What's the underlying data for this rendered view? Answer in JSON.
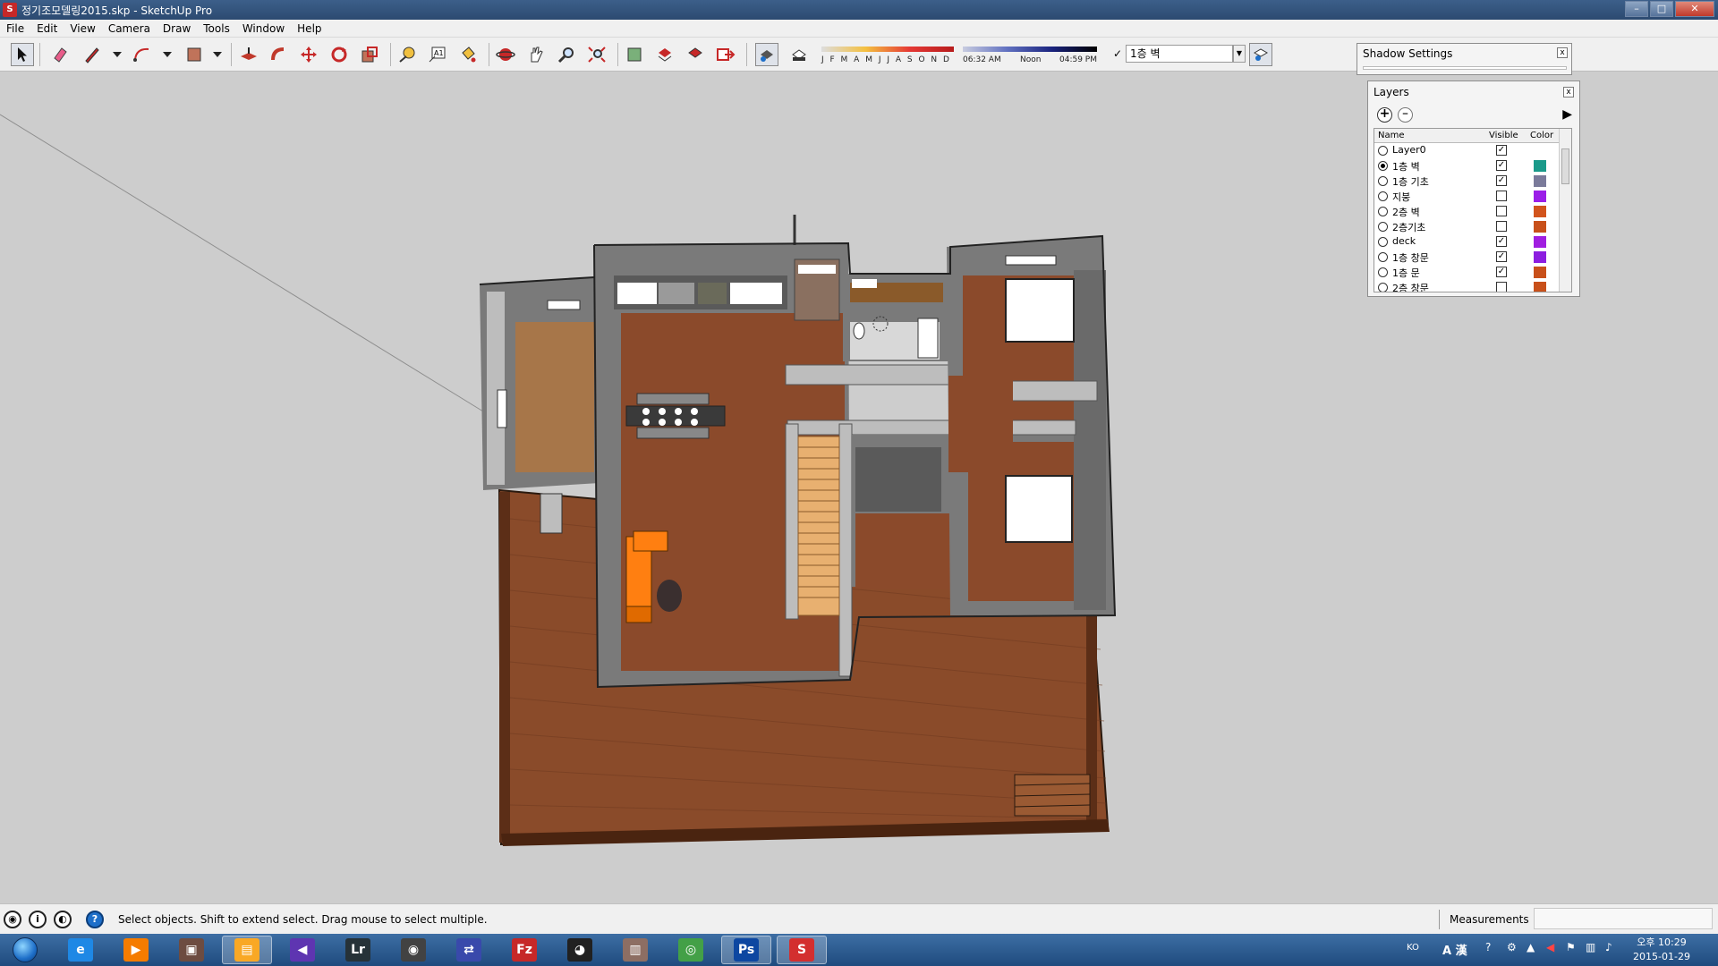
{
  "window": {
    "title": "정기조모델링2015.skp - SketchUp Pro",
    "min_label": "–",
    "max_label": "□",
    "close_label": "✕"
  },
  "menu": [
    "File",
    "Edit",
    "View",
    "Camera",
    "Draw",
    "Tools",
    "Window",
    "Help"
  ],
  "shadow_controls": {
    "months": "J F M A M J J A S O N D",
    "time_start": "06:32 AM",
    "time_mid": "Noon",
    "time_end": "04:59 PM"
  },
  "layer_dropdown": {
    "check": "✓",
    "current": "1층 벽"
  },
  "shadow_panel": {
    "title": "Shadow Settings",
    "close": "x"
  },
  "layers_panel": {
    "title": "Layers",
    "close": "x",
    "headers": {
      "name": "Name",
      "visible": "Visible",
      "color": "Color"
    },
    "layers": [
      {
        "name": "Layer0",
        "active": false,
        "visible": true,
        "color": "#ffffff"
      },
      {
        "name": "1층 벽",
        "active": true,
        "visible": true,
        "color": "#1a9a8a"
      },
      {
        "name": "1층 기초",
        "active": false,
        "visible": true,
        "color": "#7a7a9a"
      },
      {
        "name": "지붕",
        "active": false,
        "visible": false,
        "color": "#9b1ee8"
      },
      {
        "name": "2층 벽",
        "active": false,
        "visible": false,
        "color": "#d2541c"
      },
      {
        "name": "2층기초",
        "active": false,
        "visible": false,
        "color": "#c8501a"
      },
      {
        "name": "deck",
        "active": false,
        "visible": true,
        "color": "#a01ee0"
      },
      {
        "name": "1층 창문",
        "active": false,
        "visible": true,
        "color": "#8c1ee0"
      },
      {
        "name": "1층 문",
        "active": false,
        "visible": true,
        "color": "#c8501a"
      },
      {
        "name": "2층 창문",
        "active": false,
        "visible": false,
        "color": "#c8501a"
      }
    ]
  },
  "status": {
    "message": "Select objects. Shift to extend select. Drag mouse to select multiple.",
    "measurements_label": "Measurements",
    "measurements_value": ""
  },
  "taskbar": {
    "apps": [
      {
        "name": "ie",
        "label": "e"
      },
      {
        "name": "media",
        "label": "▶"
      },
      {
        "name": "photo",
        "label": "▣"
      },
      {
        "name": "explorer",
        "label": "▤"
      },
      {
        "name": "vs",
        "label": "◀"
      },
      {
        "name": "lightroom",
        "label": "Lr"
      },
      {
        "name": "camera",
        "label": "◉"
      },
      {
        "name": "network",
        "label": "⇄"
      },
      {
        "name": "filezilla",
        "label": "Fz"
      },
      {
        "name": "qq",
        "label": "◕"
      },
      {
        "name": "archive",
        "label": "▥"
      },
      {
        "name": "chrome",
        "label": "◎"
      },
      {
        "name": "photoshop",
        "label": "Ps"
      },
      {
        "name": "sketchup",
        "label": "S"
      }
    ],
    "tray_lang": "KO",
    "tray_ime": "A 漢",
    "clock_time": "오후 10:29",
    "clock_date": "2015-01-29"
  },
  "colors": {
    "floor_wood": "#8b4a2b",
    "deck_wood": "#8a4b2a",
    "wall": "#7a7a7a",
    "sofa": "#ff7f11",
    "bed": "#ffffff",
    "stair": "#e8b070"
  }
}
